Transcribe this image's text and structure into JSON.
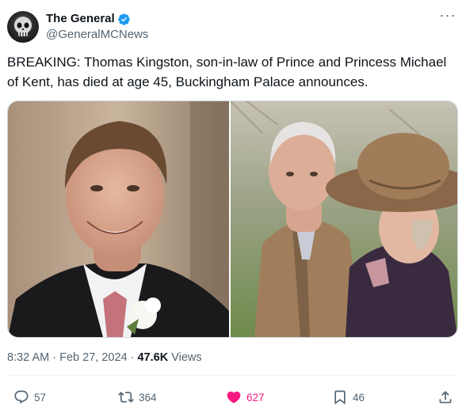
{
  "author": {
    "display_name": "The General",
    "handle": "@GeneralMCNews",
    "avatar_icon": "skull-avatar",
    "verified_color": "#1d9bf0"
  },
  "tweet": {
    "text": "BREAKING: Thomas Kingston, son-in-law of Prince and Princess Michael of Kent, has died at age 45, Buckingham Palace announces."
  },
  "meta": {
    "time": "8:32 AM",
    "separator": "·",
    "date": "Feb 27, 2024",
    "views_count": "47.6K",
    "views_label": "Views"
  },
  "actions": {
    "replies": "57",
    "reposts": "364",
    "likes": "627",
    "bookmarks": "46",
    "like_color": "#f91880"
  },
  "colors": {
    "text": "#0f1419",
    "secondary": "#536471",
    "border": "#cfd9de"
  }
}
